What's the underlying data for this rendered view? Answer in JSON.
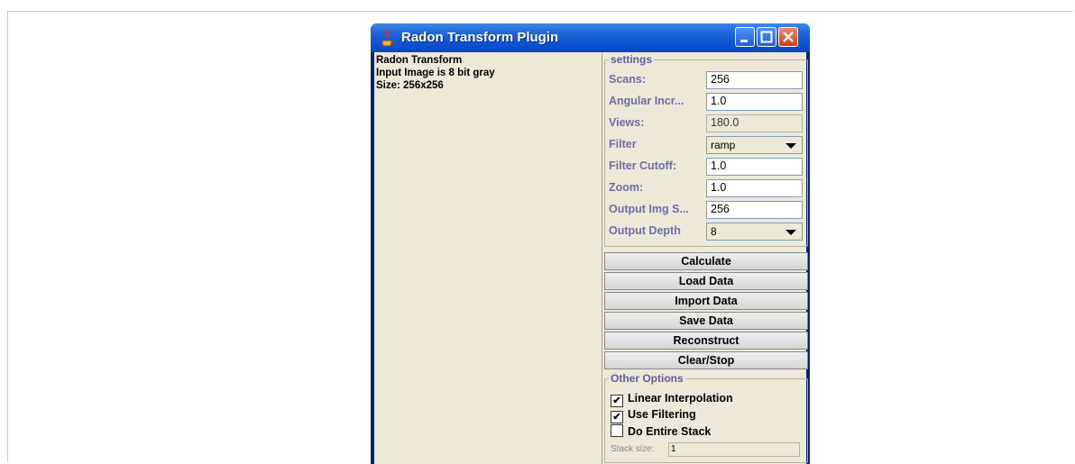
{
  "window": {
    "title": "Radon Transform Plugin"
  },
  "info": {
    "line1": "Radon Transform",
    "line2": "Input Image is 8 bit gray",
    "line3": "Size: 256x256"
  },
  "settings": {
    "legend": "settings",
    "scans_label": "Scans:",
    "scans_value": "256",
    "angular_label": "Angular Incr...",
    "angular_value": "1.0",
    "views_label": "Views:",
    "views_value": "180.0",
    "filter_label": "Filter",
    "filter_value": "ramp",
    "cutoff_label": "Filter Cutoff:",
    "cutoff_value": "1.0",
    "zoom_label": "Zoom:",
    "zoom_value": "1.0",
    "outsize_label": "Output Img S...",
    "outsize_value": "256",
    "depth_label": "Output Depth",
    "depth_value": "8"
  },
  "buttons": {
    "calculate": "Calculate",
    "load": "Load Data",
    "import": "Import Data",
    "save": "Save Data",
    "reconstruct": "Reconstruct",
    "clear": "Clear/Stop"
  },
  "options": {
    "legend": "Other Options",
    "linear": {
      "label": "Linear Interpolation",
      "mark": "✔"
    },
    "filtering": {
      "label": "Use Filtering",
      "mark": "✔"
    },
    "stack": {
      "label": "Do Entire Stack",
      "mark": ""
    },
    "stack_size_label": "Stack size:",
    "stack_size_value": "1"
  }
}
